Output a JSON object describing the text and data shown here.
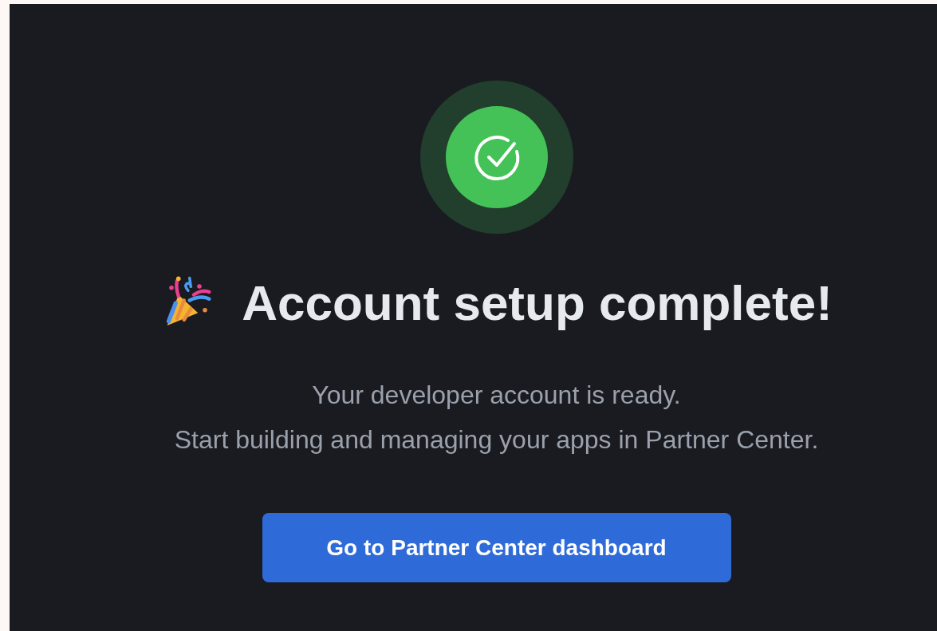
{
  "title": "Account setup complete!",
  "message": [
    "Your developer account is ready.",
    "Start building and managing your apps in Partner Center."
  ],
  "button": {
    "label": "Go to Partner Center dashboard"
  }
}
